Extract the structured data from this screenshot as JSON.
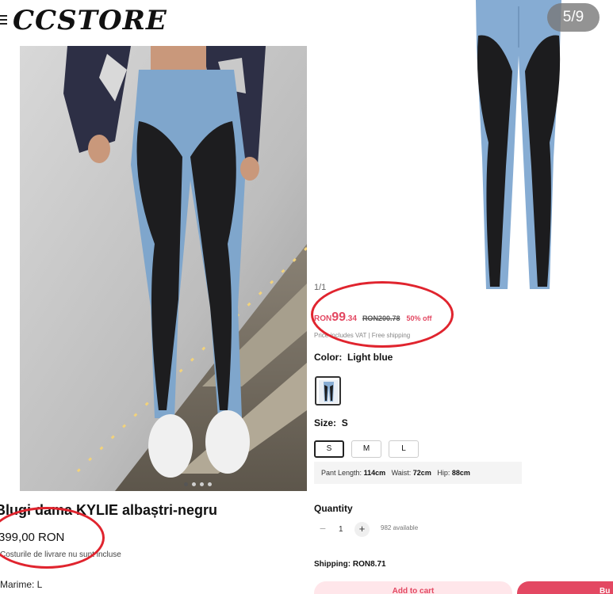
{
  "left_store": {
    "logo": "CCSTORE",
    "menu_icon": "hamburger-menu-icon",
    "product_title": "Blugi dama KYLIE albaștri-negru",
    "price": "399,00 RON",
    "shipping_note": "Costurile de livrare nu sunt incluse",
    "size_text": "Marime: L",
    "carousel_dots": 4,
    "carousel_active": 1
  },
  "right_product": {
    "image_counter": "5/9",
    "page_counter": "1/1",
    "price": {
      "currency": "RON",
      "main": "99",
      "cents": ".34",
      "original": "RON200.78",
      "discount": "50% off"
    },
    "vat_note": "Price includes VAT | Free shipping",
    "color_label": "Color:",
    "color_value": "Light blue",
    "size_label": "Size:",
    "size_value": "S",
    "sizes": [
      "S",
      "M",
      "L"
    ],
    "selected_size": "S",
    "measurements": {
      "pant_length_label": "Pant Length:",
      "pant_length": "114cm",
      "waist_label": "Waist:",
      "waist": "72cm",
      "hip_label": "Hip:",
      "hip": "88cm"
    },
    "quantity_label": "Quantity",
    "quantity": "1",
    "available": "982 available",
    "shipping": "Shipping: RON8.71",
    "add_to_cart": "Add to cart",
    "buy_now": "Bu"
  },
  "colors": {
    "price_red": "#e34862",
    "annotation_red": "#e0242e",
    "denim": "#7fa6cc",
    "panel_black": "#1a1a1a"
  }
}
